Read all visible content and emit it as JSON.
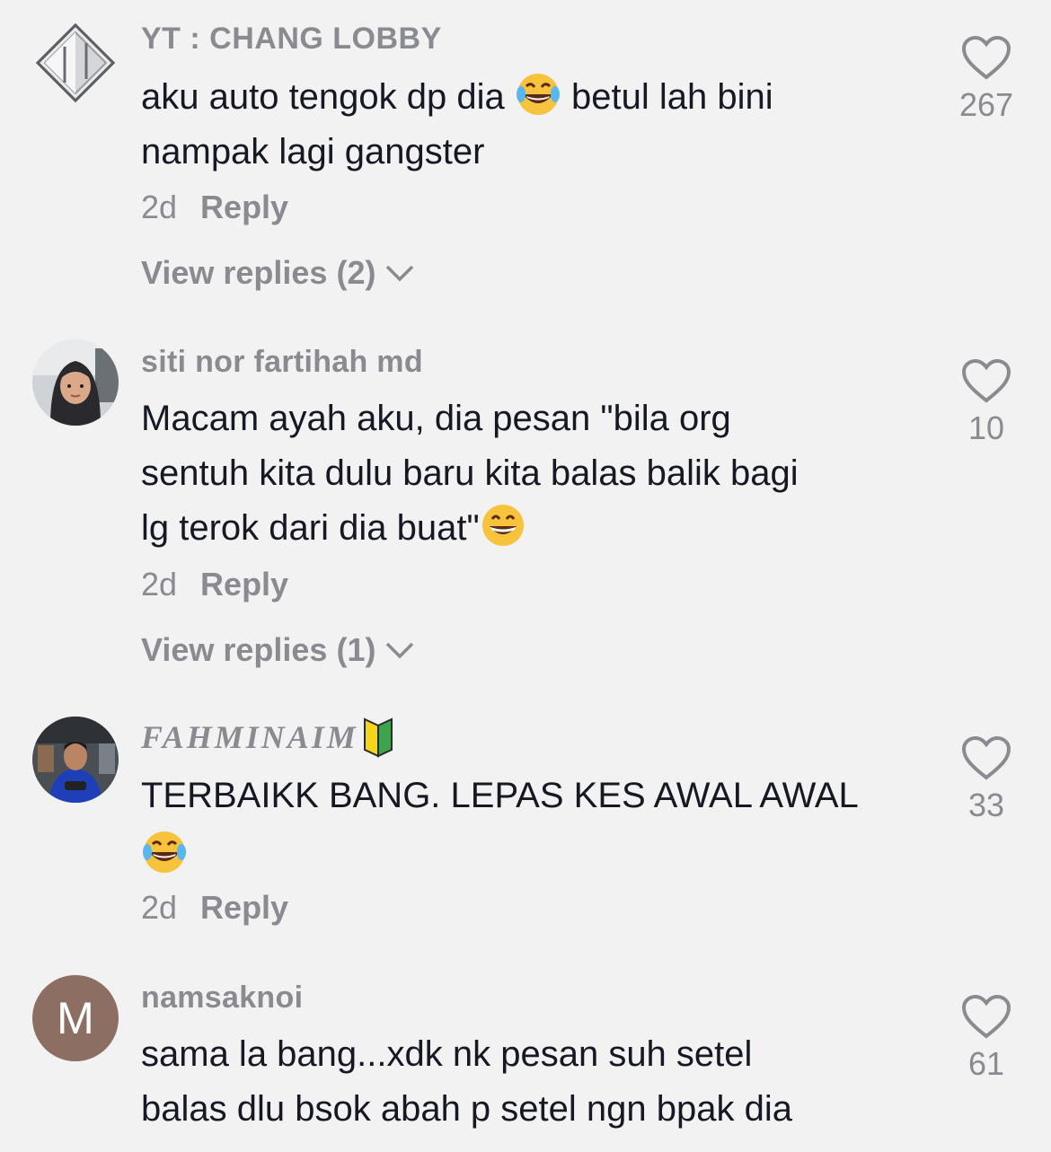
{
  "comments": [
    {
      "username": "YT : CHANG  LOBBY",
      "text_lines": [
        "aku auto tengok dp dia ",
        " betul lah bini",
        "nampak lagi gangster"
      ],
      "time": "2d",
      "reply_label": "Reply",
      "view_replies": "View replies (2)",
      "likes": "267",
      "avatar_icon": "diamond-logo"
    },
    {
      "username": "siti nor fartihah md",
      "text_lines": [
        "Macam ayah aku, dia pesan \"bila org",
        "sentuh kita dulu baru kita balas balik bagi",
        "lg terok dari dia buat\""
      ],
      "time": "2d",
      "reply_label": "Reply",
      "view_replies": "View replies (1)",
      "likes": "10",
      "avatar_icon": "photo-hijab-woman"
    },
    {
      "username": "FAHMINAIM",
      "text_lines": [
        "TERBAIKK BANG. LEPAS KES AWAL AWAL"
      ],
      "time": "2d",
      "reply_label": "Reply",
      "likes": "33",
      "avatar_icon": "photo-man-blue-shirt"
    },
    {
      "username": "namsaknoi",
      "text_lines": [
        "sama la bang...xdk nk pesan suh setel",
        "balas dlu bsok abah p setel ngn bpak dia"
      ],
      "likes": "61",
      "avatar_letter": "M",
      "avatar_color": "#8d6e63"
    }
  ],
  "colors": {
    "background": "#f2f2f3",
    "text": "#161823",
    "muted": "#8a8b91"
  }
}
